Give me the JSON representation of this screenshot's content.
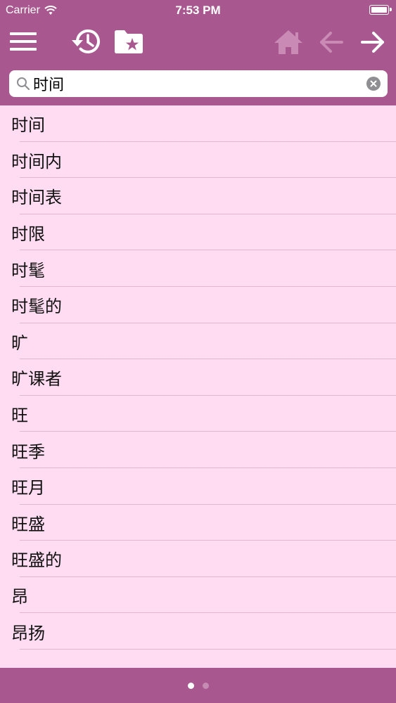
{
  "status_bar": {
    "carrier": "Carrier",
    "time": "7:53 PM"
  },
  "toolbar": {
    "icons": [
      "menu-icon",
      "history-icon",
      "favorites-folder-icon",
      "home-icon",
      "back-arrow-icon",
      "forward-arrow-icon"
    ]
  },
  "search": {
    "value": "时间",
    "placeholder": ""
  },
  "results": [
    "时间",
    "时间内",
    "时间表",
    "时限",
    "时髦",
    "时髦的",
    "旷",
    "旷课者",
    "旺",
    "旺季",
    "旺月",
    "旺盛",
    "旺盛的",
    "昂",
    "昂扬"
  ],
  "pager": {
    "pages": 2,
    "current": 1
  },
  "colors": {
    "brand": "#a9578f",
    "list_background": "#ffdcf1",
    "separator": "#e3b6cf",
    "disabled_icon": "#c98ab5"
  }
}
